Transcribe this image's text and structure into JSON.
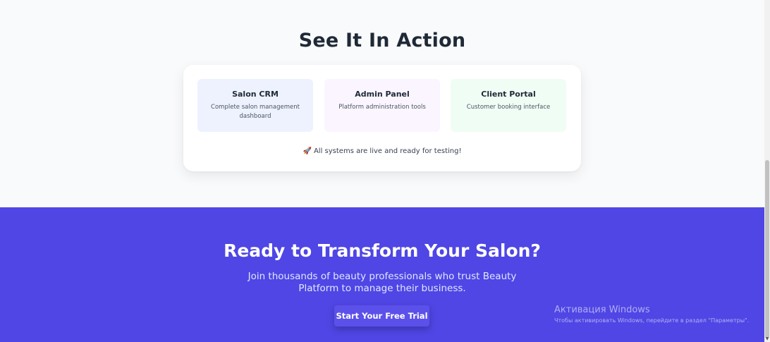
{
  "demo_section": {
    "title": "See It In Action",
    "cards": [
      {
        "title": "Salon CRM",
        "description": "Complete salon management dashboard"
      },
      {
        "title": "Admin Panel",
        "description": "Platform administration tools"
      },
      {
        "title": "Client Portal",
        "description": "Customer booking interface"
      }
    ],
    "status_icon": "rocket-icon",
    "status_text": "All systems are live and ready for testing!"
  },
  "cta_section": {
    "title": "Ready to Transform Your Salon?",
    "subtitle": "Join thousands of beauty professionals who trust Beauty Platform to manage their business.",
    "button_label": "Start Your Free Trial",
    "accent_color": "#4f46e5"
  },
  "windows_activation": {
    "title": "Активация Windows",
    "subtitle": "Чтобы активировать Windows, перейдите в раздел \"Параметры\"."
  }
}
